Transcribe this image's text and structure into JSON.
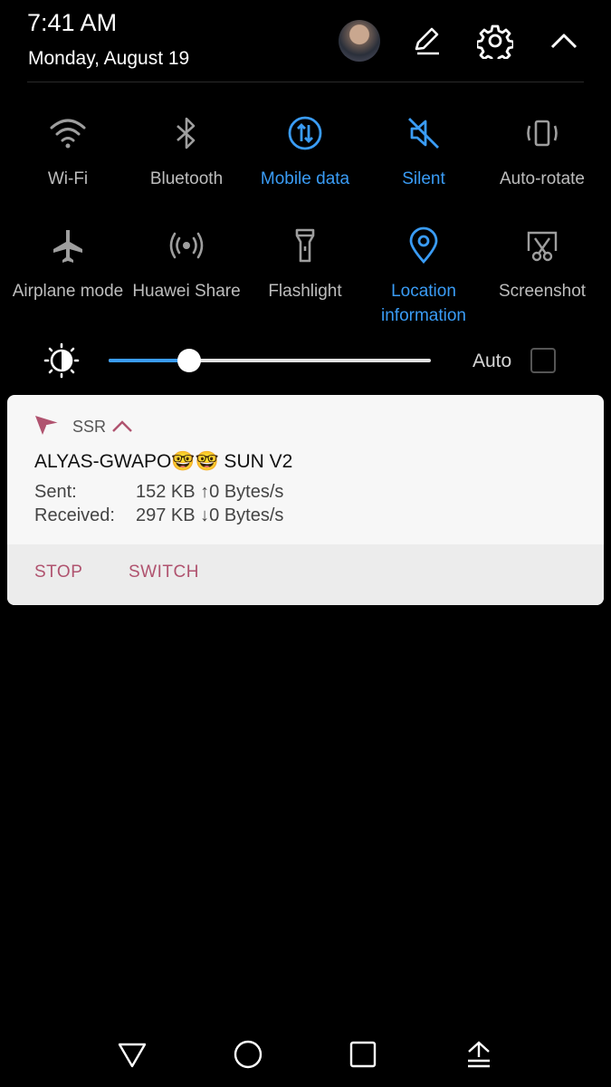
{
  "status": {
    "time": "7:41 AM",
    "date": "Monday, August 19"
  },
  "header_icons": {
    "edit": "edit-icon",
    "settings": "gear-icon",
    "collapse": "chevron-up-icon"
  },
  "tiles": [
    {
      "label": "Wi-Fi",
      "icon": "wifi-icon",
      "active": false
    },
    {
      "label": "Bluetooth",
      "icon": "bluetooth-icon",
      "active": false
    },
    {
      "label": "Mobile data",
      "icon": "mobile-data-icon",
      "active": true
    },
    {
      "label": "Silent",
      "icon": "silent-icon",
      "active": true
    },
    {
      "label": "Auto-rotate",
      "icon": "auto-rotate-icon",
      "active": false
    },
    {
      "label": "Airplane mode",
      "icon": "airplane-icon",
      "active": false
    },
    {
      "label": "Huawei Share",
      "icon": "huawei-share-icon",
      "active": false
    },
    {
      "label": "Flashlight",
      "icon": "flashlight-icon",
      "active": false
    },
    {
      "label": "Location information",
      "icon": "location-icon",
      "active": true
    },
    {
      "label": "Screenshot",
      "icon": "screenshot-icon",
      "active": false
    }
  ],
  "brightness": {
    "level": 0.25,
    "auto_label": "Auto",
    "auto_checked": false
  },
  "notification": {
    "app_name": "SSR",
    "title": "ALYAS-GWAPO🤓🤓 SUN V2",
    "sent_label": "Sent:",
    "sent_value": "152 KB ↑0 Bytes/s",
    "received_label": "Received:",
    "received_value": "297 KB ↓0 Bytes/s",
    "actions": {
      "stop": "STOP",
      "switch": "SWITCH"
    }
  },
  "colors": {
    "accent": "#3a9cf5",
    "inactive": "#bdbdbd",
    "action": "#b0536f",
    "background": "#000000"
  }
}
